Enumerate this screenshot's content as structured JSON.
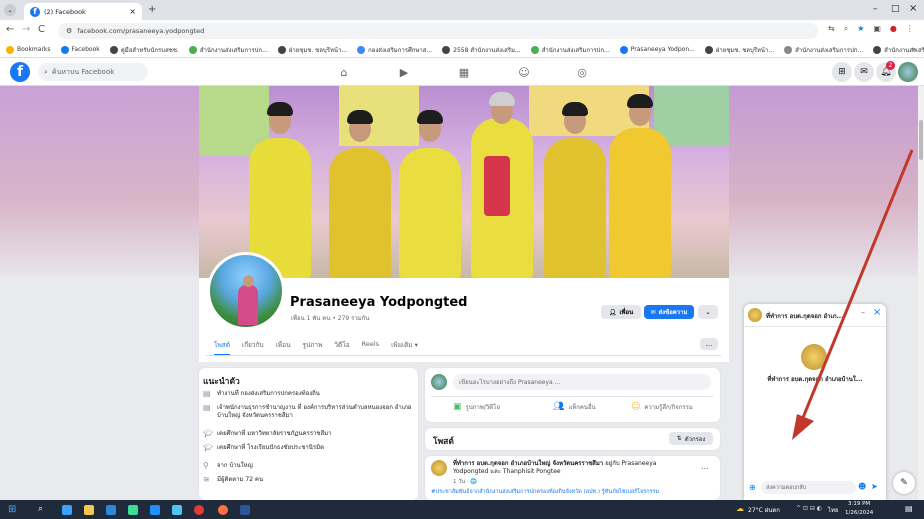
{
  "browser": {
    "tab_title": "(2) Facebook",
    "tab_close": "×",
    "new_tab": "+",
    "url": "facebook.com/prasaneeya.yodpongted",
    "window_controls": [
      "–",
      "□",
      "×"
    ],
    "bookmarks": [
      {
        "label": "Bookmarks",
        "color": "#f4b400"
      },
      {
        "label": "Facebook",
        "color": "#1877f2"
      },
      {
        "label": "คู่มือสำหรับนักรบสชช.",
        "color": "#444"
      },
      {
        "label": "สำนักงานส่งเสริมการปก...",
        "color": "#4caf50"
      },
      {
        "label": "ฝ่ายชุมช. ชลบุรีหน้า...",
        "color": "#444"
      },
      {
        "label": "กองส่งเสริมการศึกษาส...",
        "color": "#4285f4"
      },
      {
        "label": "2558 สำนักงานส่งเสริม...",
        "color": "#444"
      },
      {
        "label": "สำนักงานส่งเสริมการปก...",
        "color": "#4caf50"
      },
      {
        "label": "Prasaneeya Yodpon...",
        "color": "#1877f2"
      },
      {
        "label": "ฝ่ายชุมช. ชลบุรีหน้า...",
        "color": "#444"
      },
      {
        "label": "สำนักงานส่งเสริมการปก...",
        "color": "#888"
      },
      {
        "label": "สำนักงานส่งเสริมการปก...",
        "color": "#444"
      }
    ],
    "more_bookmarks": "»"
  },
  "facebook": {
    "search_placeholder": "ค้นหาบน Facebook",
    "nav_icons": [
      "home-icon",
      "video-icon",
      "marketplace-icon",
      "groups-icon",
      "gaming-icon"
    ],
    "notification_badge": "2",
    "profile": {
      "name": "Prasaneeya Yodpongted",
      "friends": "เพื่อน 1 พัน คน • 279 รวมกัน",
      "friends_button": "เพื่อน",
      "message_button": "ส่งข้อความ",
      "more_button": "⌄"
    },
    "tabs": [
      "โพสต์",
      "เกี่ยวกับ",
      "เพื่อน",
      "รูปภาพ",
      "วิดีโอ",
      "Reels",
      "เพิ่มเติม ▾"
    ],
    "tabs_more": "...",
    "intro": {
      "title": "แนะนำตัว",
      "rows": [
        {
          "icon": "briefcase-icon",
          "text": "ทำงานที่ กองส่งเสริมการปกครองท้องถิ่น"
        },
        {
          "icon": "briefcase-icon",
          "text": "เจ้าพนักงานธุรการชำนาญงาน ที่ องค์การบริหารส่วนตำบลหนองจอก อำเภอบ้านใหญ่ จังหวัดนครราชสีมา"
        },
        {
          "icon": "graduation-icon",
          "text": "เคยศึกษาที่ มหาวิทยาลัยราชภัฏนครราชสีมา"
        },
        {
          "icon": "graduation-icon",
          "text": "เคยศึกษาที่ โรงเรียนปักธงชัยประชานิรมิต"
        },
        {
          "icon": "location-icon",
          "text": "จาก บ้านใหญ่"
        },
        {
          "icon": "rss-icon",
          "text": "มีผู้ติดตาม 72 คน"
        }
      ]
    },
    "composer": {
      "placeholder": "เขียนอะไรบางอย่างถึง Prasaneeya ...",
      "actions": [
        "รูปภาพ/วิดีโอ",
        "แท็กคนอื่น",
        "ความรู้สึก/กิจกรรม"
      ]
    },
    "posts": {
      "title": "โพสต์",
      "filter": "ตัวกรอง"
    },
    "post": {
      "author": "ที่ทำการ อบต.กุดจอก อำเภอบ้านใหญ่ จังหวัดนครราชสีมา",
      "with": "อยู่กับ Prasaneeya Yodpongted และ Thanphisit Pongtee",
      "time": "1 วัน · 🌐",
      "text": "#ประชาสัมพันธ์จากสำนักงานส่งเสริมการปกครองท้องถิ่นจังหวัด (อปท.) รู้ทันภัยไซเบอร์โจรกรรม",
      "more": "..."
    },
    "chat": {
      "header": "ที่ทำการ อบต.กุดจอก อำเภ...",
      "page_name": "ที่ทำการ อบต.กุดจอก อำเภอบ้านใ...",
      "input_placeholder": "ส่งความตอบกลับ",
      "close": "×",
      "min": "–"
    }
  },
  "taskbar": {
    "weather": "27°C ฝนตก",
    "time": "3:19 PM",
    "date": "1/26/2024",
    "lang": "ไทย"
  },
  "colors": {
    "fb_blue": "#1877f2",
    "arrow_red": "#c0392b"
  }
}
